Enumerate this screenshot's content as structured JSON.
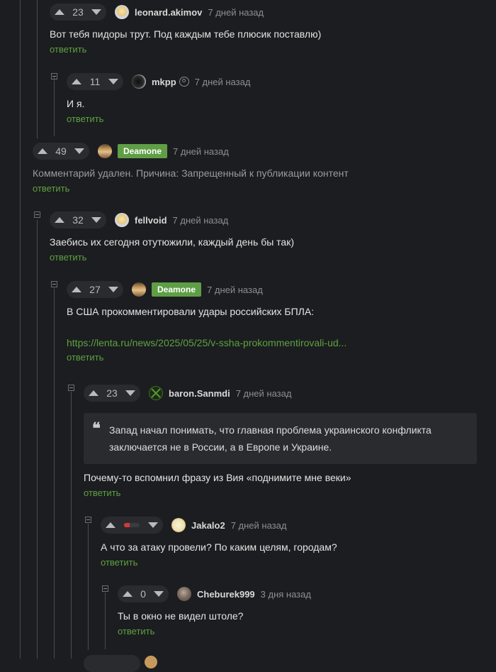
{
  "reply_label": "ответить",
  "colors": {
    "accent": "#5da140",
    "badge": "#5f9e46",
    "background": "#1c1d20"
  },
  "comments": [
    {
      "rating": "23",
      "user": "leonard.akimov",
      "date": "7 дней назад",
      "text": "Вот тебя пидоры трут. Под каждым тебе плюсик поставлю)"
    },
    {
      "rating": "11",
      "user": "mkpp",
      "date": "7 дней назад",
      "text": "И я.",
      "icon": "subscribe-user-icon"
    },
    {
      "rating": "49",
      "user": "Deamone",
      "date": "7 дней назад",
      "text": "Комментарий удален. Причина: Запрещенный к публикации контент",
      "badge": true
    },
    {
      "rating": "32",
      "user": "fellvoid",
      "date": "7 дней назад",
      "text": "Заебись их сегодня отутюжили, каждый день бы так)"
    },
    {
      "rating": "27",
      "user": "Deamone",
      "date": "7 дней назад",
      "text": "В США прокомментировали удары российских БПЛА:",
      "link": "https://lenta.ru/news/2025/05/25/v-ssha-prokommentirovali-ud...",
      "badge": true
    },
    {
      "rating": "23",
      "user": "baron.Sanmdi",
      "date": "7 дней назад",
      "quote": [
        "Запад начал понимать, что главная проблема украинского конфликта",
        "заключается не в России, а в Европе и Украине."
      ],
      "text": "Почему-то вспомнил фразу из Вия «поднимите мне веки»"
    },
    {
      "rating_indicator": 0.35,
      "user": "Jakalo2",
      "date": "7 дней назад",
      "text": "А что за атаку провели? По каким целям, городам?"
    },
    {
      "rating": "0",
      "user": "Cheburek999",
      "date": "3 дня назад",
      "text": "Ты в окно не видел штоле?"
    }
  ]
}
